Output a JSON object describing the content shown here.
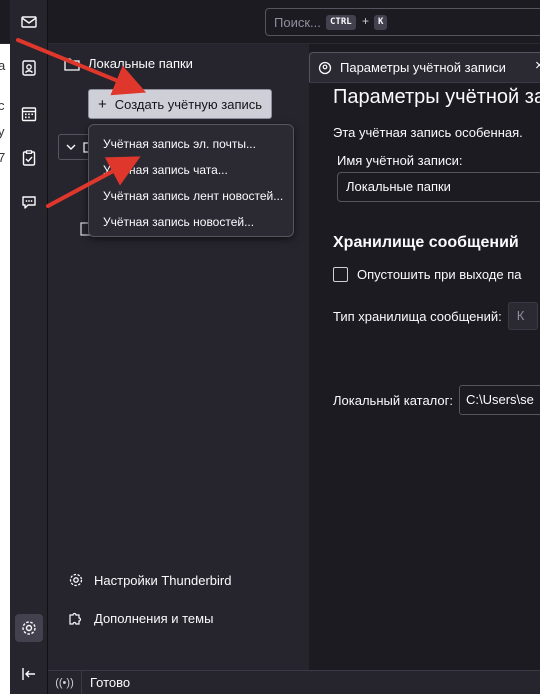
{
  "search": {
    "placeholder": "Поиск...",
    "shortcut_ctrl": "CTRL",
    "shortcut_plus": "+",
    "shortcut_key": "K"
  },
  "background_window_fragments": [
    "а",
    "с",
    "у",
    "7"
  ],
  "spaces": [
    {
      "icon": "mail-icon"
    },
    {
      "icon": "address-book-icon"
    },
    {
      "icon": "calendar-icon"
    },
    {
      "icon": "tasks-icon"
    },
    {
      "icon": "chat-icon"
    }
  ],
  "folder_pane": {
    "header_label": "Локальные папки",
    "create_button": "Создать учётную запись",
    "settings_label": "Настройки Thunderbird",
    "addons_label": "Дополнения и темы"
  },
  "menu": {
    "items": [
      "Учётная запись эл. почты...",
      "Учётная запись чата...",
      "Учётная запись лент новостей...",
      "Учётная запись новостей..."
    ]
  },
  "tab": {
    "label": "Параметры учётной записи",
    "close": "×"
  },
  "account_settings": {
    "title": "Параметры учётной за",
    "note": "Эта учётная запись особенная.",
    "name_label": "Имя учётной записи:",
    "name_value": "Локальные папки",
    "storage_heading": "Хранилище сообщений",
    "empty_on_exit_label": "Опустошить при выходе па",
    "store_type_label": "Тип хранилища сообщений:",
    "store_type_value": "К",
    "local_dir_label": "Локальный каталог:",
    "local_dir_value": "C:\\Users\\se"
  },
  "status": {
    "icon": "((•))",
    "text": "Готово"
  },
  "colors": {
    "annotation_arrow": "#e0372d",
    "button_bg": "#cfcfd8"
  }
}
